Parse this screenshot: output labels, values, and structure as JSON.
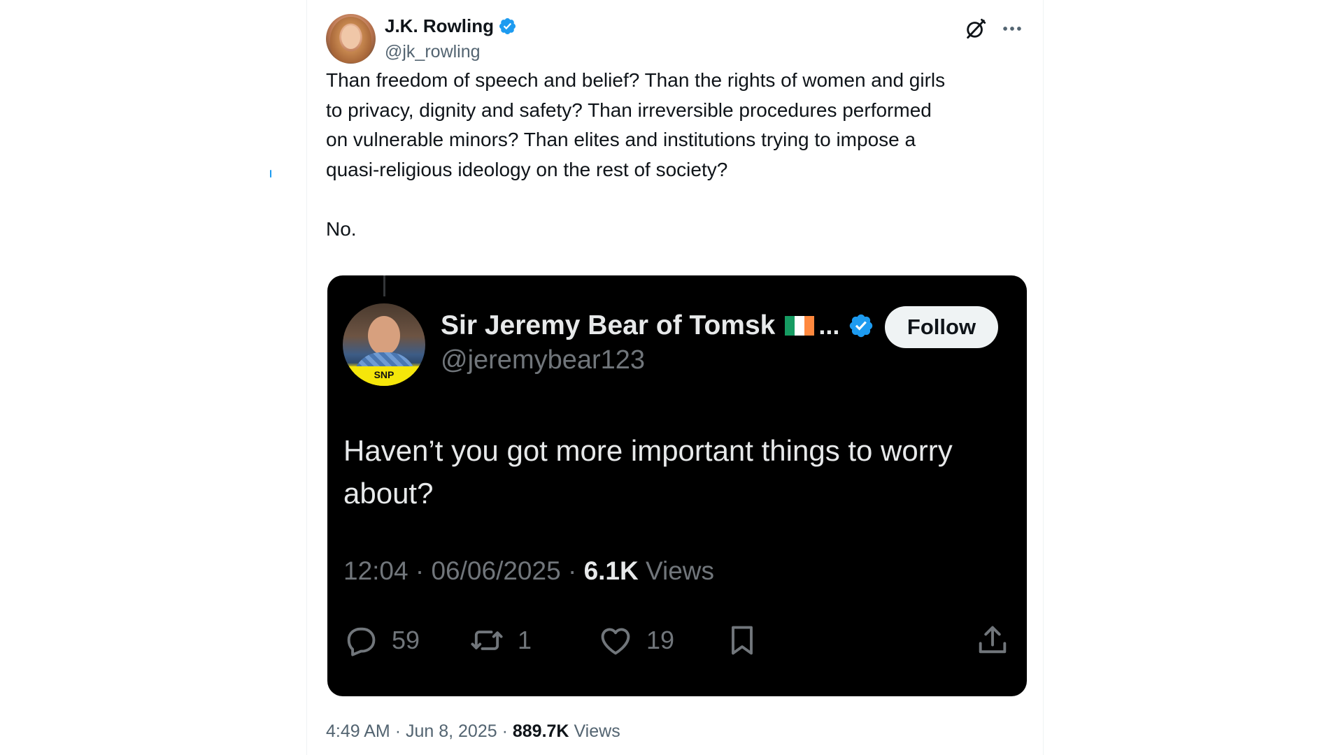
{
  "author": {
    "display_name": "J.K. Rowling",
    "handle": "@jk_rowling",
    "verified": true
  },
  "header_icons": [
    "grok-icon",
    "more-icon"
  ],
  "tweet": {
    "text": "Than freedom of speech and belief? Than the rights of women and girls\nto privacy, dignity and safety? Than irreversible procedures performed\non vulnerable minors? Than elites and institutions trying to impose a\nquasi-religious ideology on the rest of society?\n\nNo.",
    "time": "4:49 AM",
    "date": "Jun 8, 2025",
    "views_count": "889.7K",
    "views_label": "Views",
    "separator": "·"
  },
  "quoted_screenshot": {
    "display_name": "Sir Jeremy Bear of Tomsk",
    "ellipsis": "...",
    "handle": "@jeremybear123",
    "verified": true,
    "follow_label": "Follow",
    "avatar_badge": "SNP",
    "text": "Haven’t you got more important things to worry about?",
    "time": "12:04",
    "date": "06/06/2025",
    "views_count": "6.1K",
    "views_label": "Views",
    "separator": "·",
    "actions": {
      "replies": "59",
      "reposts": "1",
      "likes": "19"
    },
    "colors": {
      "background": "#000000",
      "text": "#e7e9ea",
      "muted": "#71767b",
      "verified": "#1d9bf0"
    },
    "flag_colors": [
      "#169b62",
      "#ffffff",
      "#ff883e"
    ]
  },
  "colors": {
    "verified": "#1d9bf0",
    "muted": "#536471",
    "text": "#0f1419"
  }
}
